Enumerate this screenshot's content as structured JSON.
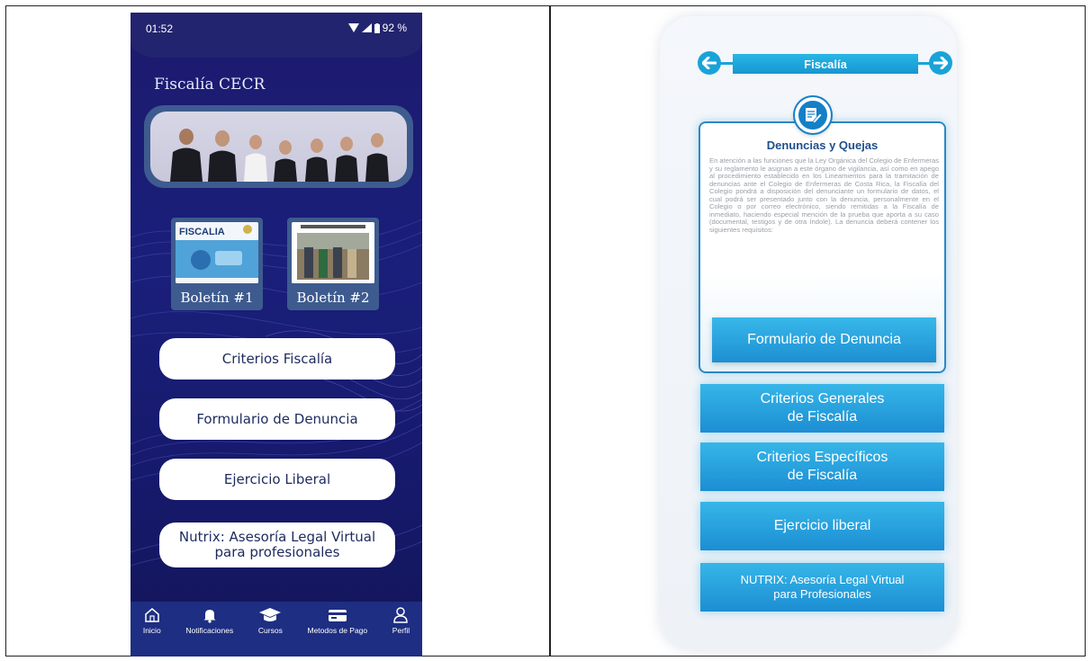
{
  "left_app": {
    "status_bar": {
      "time": "01:52",
      "battery": "92 %"
    },
    "title": "Fiscalía CECR",
    "bulletins": [
      {
        "label": "Boletín #1",
        "thumb_title": "FISCALIA"
      },
      {
        "label": "Boletín #2"
      }
    ],
    "buttons": [
      "Criterios Fiscalía",
      "Formulario de Denuncia",
      "Ejercicio Liberal",
      "Nutrix: Asesoría Legal Virtual\npara profesionales"
    ],
    "nav": [
      "Inicio",
      "Notificaciones",
      "Cursos",
      "Metodos de Pago",
      "Perfil"
    ],
    "colors": {
      "background": "#1c1a6e",
      "nav": "#1e2e82",
      "pill_text": "#1d2a5e"
    }
  },
  "right_app": {
    "header_title": "Fiscalía",
    "card": {
      "title": "Denuncias y Quejas",
      "body": "En atención a las funciones que la Ley Orgánica del Colegio de Enfermeras y su reglamento le asignan a este órgano de vigilancia, así como en apego al procedimiento establecido en los Lineamientos para la tramitación de denuncias ante el Colegio de Enfermeras de Costa Rica, la Fiscalía del Colegio pondrá a disposición del denunciante un formulario de datos, el cual podrá ser presentado junto con la denuncia, personalmente en el Colegio o por correo electrónico, siendo remitidas a la Fiscalía de inmediato, haciendo especial mención de la prueba que aporta a su caso (documental, testigos y de otra índole). La denuncia deberá contener los siguientes requisitos:",
      "button": "Formulario de Denuncia"
    },
    "buttons": [
      "Criterios Generales\nde Fiscalía",
      "Criterios Específicos\nde Fiscalía",
      "Ejercicio liberal",
      "NUTRIX: Asesoría Legal Virtual\npara Profesionales"
    ],
    "colors": {
      "accent": "#1aa3d8",
      "card_title": "#1f4f8c"
    }
  }
}
